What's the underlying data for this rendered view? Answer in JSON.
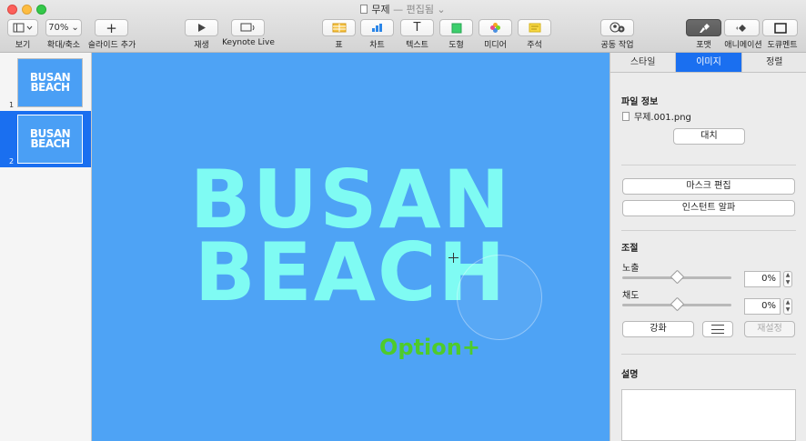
{
  "window": {
    "title": "무제",
    "subtitle": "— 편집됨 ⌄"
  },
  "toolbar": {
    "view_label": "보기",
    "zoom_value": "70%",
    "zoom_label": "확대/축소",
    "add_slide_label": "슬라이드 추가",
    "play_label": "재생",
    "keynote_live_label": "Keynote Live",
    "table_label": "표",
    "chart_label": "차트",
    "text_label": "텍스트",
    "shape_label": "도형",
    "media_label": "미디어",
    "comment_label": "주석",
    "collaborate_label": "공동 작업",
    "format_label": "포맷",
    "animate_label": "애니메이션",
    "document_label": "도큐멘트"
  },
  "navigator": {
    "slides": [
      {
        "number": "1",
        "line1": "BUSAN",
        "line2": "BEACH",
        "selected": false
      },
      {
        "number": "2",
        "line1": "BUSAN",
        "line2": "BEACH",
        "selected": true
      }
    ]
  },
  "canvas": {
    "line1": "BUSAN",
    "line2": "BEACH",
    "option_hint": "Option+",
    "background_color": "#4ea3f5",
    "text_color": "#7ffbf3"
  },
  "inspector": {
    "tabs": [
      {
        "label": "스타일",
        "active": false
      },
      {
        "label": "이미지",
        "active": true
      },
      {
        "label": "정렬",
        "active": false
      }
    ],
    "file_info_title": "파일 정보",
    "file_name": "무제.001.png",
    "replace_button": "대치",
    "edit_mask_button": "마스크 편집",
    "instant_alpha_button": "인스턴트 알파",
    "adjust_title": "조절",
    "exposure_label": "노출",
    "exposure_value": "0%",
    "saturation_label": "채도",
    "saturation_value": "0%",
    "enhance_button": "강화",
    "reset_button": "재설정",
    "description_title": "설명"
  },
  "accent_color": "#1a6ff0"
}
